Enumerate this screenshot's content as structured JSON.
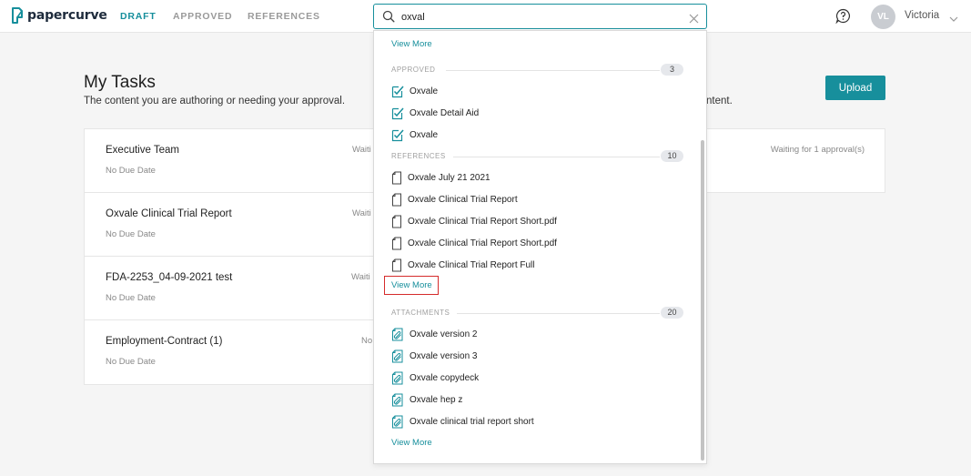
{
  "brand": {
    "name": "papercurve"
  },
  "nav": {
    "draft": "DRAFT",
    "approved": "APPROVED",
    "references": "REFERENCES"
  },
  "user": {
    "initials": "VL",
    "name": "Victoria"
  },
  "icons": {
    "logo": "papercurve-logo",
    "help": "question-bubble-icon",
    "search": "search-icon",
    "clear": "close-icon",
    "approved_doc": "approved-document-icon",
    "reference_doc": "document-icon",
    "attachment": "paperclip-document-icon"
  },
  "colors": {
    "accent": "#178f9c",
    "highlight_border": "#d52b2b"
  },
  "main": {
    "title": "My Tasks",
    "subtitle": "The content you are authoring or needing your approval.",
    "subtitle_tail": "ntent.",
    "upload_label": "Upload",
    "tasks": [
      {
        "name": "Executive Team",
        "due": "No Due Date",
        "status": "Waiti"
      },
      {
        "name": "Oxvale Clinical Trial Report",
        "due": "No Due Date",
        "status": "Waiti"
      },
      {
        "name": "FDA-2253_04-09-2021 test",
        "due": "No Due Date",
        "status": "Waiti"
      },
      {
        "name": "Employment-Contract (1)",
        "due": "No Due Date",
        "status": "No"
      }
    ],
    "right_card_status": "Waiting for 1 approval(s)"
  },
  "search": {
    "value": "oxval",
    "placeholder": ""
  },
  "dropdown": {
    "top_link": "View More",
    "approved": {
      "label": "APPROVED",
      "count": "3",
      "items": [
        "Oxvale",
        "Oxvale Detail Aid",
        "Oxvale"
      ]
    },
    "references": {
      "label": "REFERENCES",
      "count": "10",
      "items": [
        "Oxvale July 21 2021",
        "Oxvale Clinical Trial Report",
        "Oxvale Clinical Trial Report Short.pdf",
        "Oxvale Clinical Trial Report Short.pdf",
        "Oxvale Clinical Trial Report Full"
      ],
      "link": "View More"
    },
    "attachments": {
      "label": "ATTACHMENTS",
      "count": "20",
      "items": [
        "Oxvale version 2",
        "Oxvale version 3",
        "Oxvale copydeck",
        "Oxvale hep z",
        "Oxvale clinical trial report short"
      ],
      "link": "View More"
    }
  }
}
